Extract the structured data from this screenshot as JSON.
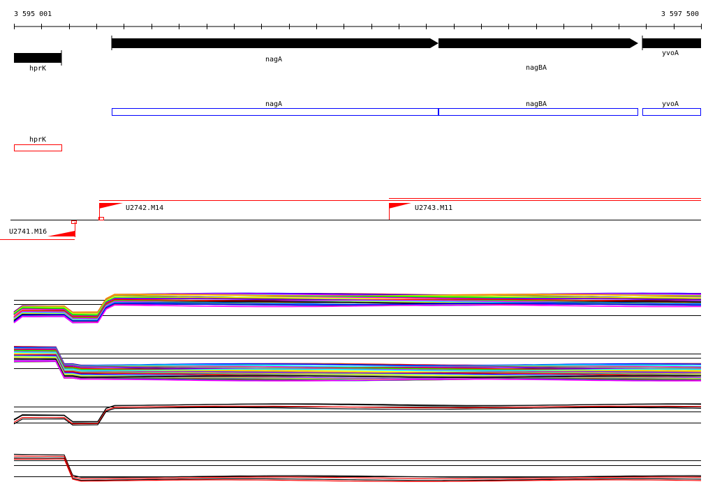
{
  "ruler": {
    "start_label": "3 595 001",
    "end_label": "3 597 500",
    "start": 3595001,
    "end": 3597500
  },
  "genes": [
    {
      "name": "hprK",
      "start": 3595001,
      "end": 3595175,
      "strand": "-"
    },
    {
      "name": "nagA",
      "start": 3595357,
      "end": 3596545,
      "strand": "+"
    },
    {
      "name": "nagBA",
      "start": 3596545,
      "end": 3597271,
      "strand": "+"
    },
    {
      "name": "yvoA",
      "start": 3597287,
      "end": 3597500,
      "strand": "+"
    }
  ],
  "annotated_genes": [
    {
      "name": "nagA"
    },
    {
      "name": "nagBA"
    },
    {
      "name": "yvoA"
    },
    {
      "name": "hprK"
    }
  ],
  "promoters": [
    {
      "name": "U2742.M14",
      "strand": "+"
    },
    {
      "name": "U2743.M11",
      "strand": "+"
    },
    {
      "name": "U2741.M16",
      "strand": "-"
    }
  ],
  "colors": {
    "gene": "#000000",
    "annotation_plus": "#0000ff",
    "annotation_minus": "#ff0000",
    "promoter": "#ff0000",
    "profile_palette": [
      "#ff0000",
      "#00ff00",
      "#0000ff",
      "#ff00ff",
      "#00ffff",
      "#ffff00",
      "#ff8800",
      "#888888",
      "#000000",
      "#8800ff",
      "#ccff00",
      "#0088ff"
    ]
  }
}
